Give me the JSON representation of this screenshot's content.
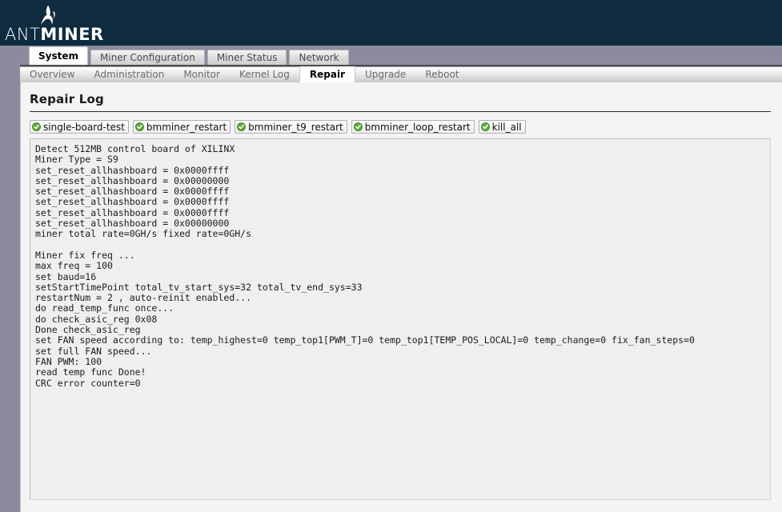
{
  "header": {
    "logo_word_1": "ANT",
    "logo_word_2": "MINER",
    "logo_icon": "ant-logo-icon"
  },
  "colors": {
    "header_bg": "#0e2b40",
    "tabbar_bg": "#8d8a9e",
    "content_bg": "#f4f4f6",
    "log_bg": "#efefef",
    "check_green": "#5faa3c",
    "active_tab_bg": "#ffffff"
  },
  "main_tabs": [
    {
      "label": "System",
      "active": true
    },
    {
      "label": "Miner Configuration",
      "active": false
    },
    {
      "label": "Miner Status",
      "active": false
    },
    {
      "label": "Network",
      "active": false
    }
  ],
  "sub_tabs": [
    {
      "label": "Overview",
      "active": false
    },
    {
      "label": "Administration",
      "active": false
    },
    {
      "label": "Monitor",
      "active": false
    },
    {
      "label": "Kernel Log",
      "active": false
    },
    {
      "label": "Repair",
      "active": true
    },
    {
      "label": "Upgrade",
      "active": false
    },
    {
      "label": "Reboot",
      "active": false
    }
  ],
  "page": {
    "title": "Repair Log"
  },
  "action_buttons": [
    {
      "label": "single-board-test",
      "icon": "green-check-icon"
    },
    {
      "label": "bmminer_restart",
      "icon": "green-check-icon"
    },
    {
      "label": "bmminer_t9_restart",
      "icon": "green-check-icon"
    },
    {
      "label": "bmminer_loop_restart",
      "icon": "green-check-icon"
    },
    {
      "label": "kill_all",
      "icon": "green-check-icon"
    }
  ],
  "log": {
    "text": "Detect 512MB control board of XILINX\nMiner Type = S9\nset_reset_allhashboard = 0x0000ffff\nset_reset_allhashboard = 0x00000000\nset_reset_allhashboard = 0x0000ffff\nset_reset_allhashboard = 0x0000ffff\nset_reset_allhashboard = 0x0000ffff\nset_reset_allhashboard = 0x00000000\nminer total rate=0GH/s fixed rate=0GH/s\n\nMiner fix freq ...\nmax freq = 100\nset baud=16\nsetStartTimePoint total_tv_start_sys=32 total_tv_end_sys=33\nrestartNum = 2 , auto-reinit enabled...\ndo read_temp_func once...\ndo check_asic_reg 0x08\nDone check_asic_reg\nset FAN speed according to: temp_highest=0 temp_top1[PWM_T]=0 temp_top1[TEMP_POS_LOCAL]=0 temp_change=0 fix_fan_steps=0\nset full FAN speed...\nFAN PWM: 100\nread temp func Done!\nCRC error counter=0"
  }
}
